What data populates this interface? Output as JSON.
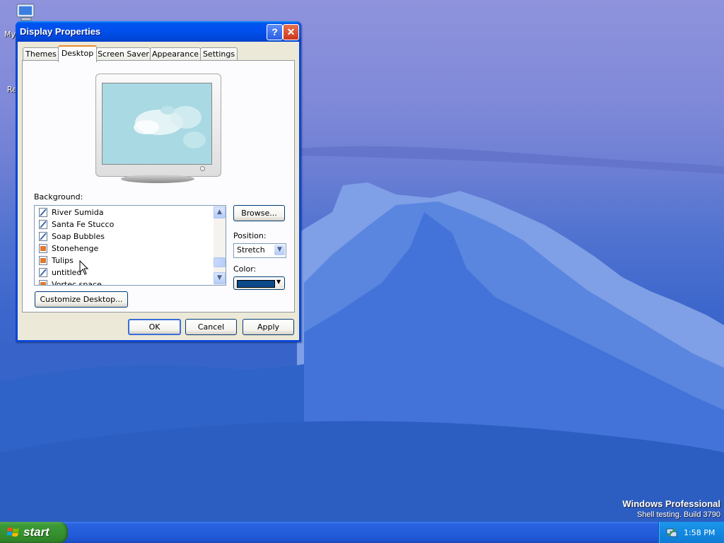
{
  "window": {
    "title": "Display Properties",
    "help_label": "?",
    "close_label": "✕"
  },
  "tabs": [
    {
      "label": "Themes"
    },
    {
      "label": "Desktop"
    },
    {
      "label": "Screen Saver"
    },
    {
      "label": "Appearance"
    },
    {
      "label": "Settings"
    }
  ],
  "active_tab": "Desktop",
  "desktop_tab": {
    "background_label": "Background:",
    "background_items": [
      {
        "label": "River Sumida",
        "icon": "bitmap-file-icon"
      },
      {
        "label": "Santa Fe Stucco",
        "icon": "bitmap-file-icon"
      },
      {
        "label": "Soap Bubbles",
        "icon": "bitmap-file-icon"
      },
      {
        "label": "Stonehenge",
        "icon": "jpeg-image-icon"
      },
      {
        "label": "Tulips",
        "icon": "jpeg-image-icon"
      },
      {
        "label": "untitled",
        "icon": "bitmap-file-icon"
      },
      {
        "label": "Vortec space",
        "icon": "jpeg-image-icon"
      }
    ],
    "scroll_up_label": "▲",
    "scroll_down_label": "▼",
    "browse_label": "Browse...",
    "position_label": "Position:",
    "position_value": "Stretch",
    "position_arrow": "▼",
    "color_label": "Color:",
    "color_value": "#0c4a8c",
    "color_arrow": "▼",
    "customize_label": "Customize Desktop..."
  },
  "buttons": {
    "ok": "OK",
    "cancel": "Cancel",
    "apply": "Apply"
  },
  "desktop": {
    "icons": [
      {
        "label": "My",
        "icon": "my-computer-icon"
      },
      {
        "label": "Re",
        "icon": "recycle-bin-icon"
      }
    ],
    "watermark_line1": "Windows Professional",
    "watermark_line2": "Shell testing. Build 3790"
  },
  "taskbar": {
    "start_label": "start",
    "clock": "1:58 PM",
    "tray_icon": "network-tray-icon"
  },
  "colors": {
    "titlebar": "#0050ee",
    "dialog_face": "#ece9d8",
    "start_green": "#3c9a37",
    "taskbar_blue": "#245ddb"
  }
}
